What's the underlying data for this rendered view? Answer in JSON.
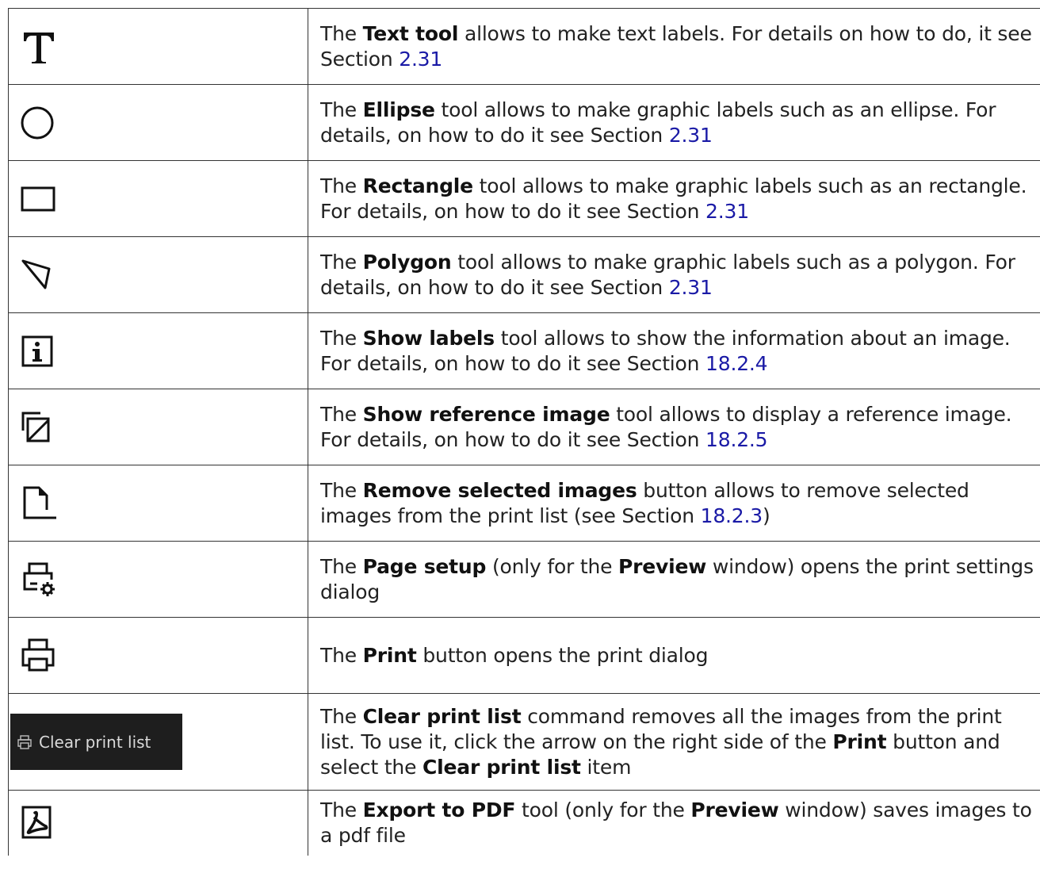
{
  "rows": [
    {
      "icon": "text-tool-icon",
      "parts": [
        {
          "t": "The "
        },
        {
          "t": "Text tool",
          "b": true
        },
        {
          "t": " allows to make text labels. For details on how to do, it see Section "
        },
        {
          "t": "2.31",
          "ref": true
        }
      ]
    },
    {
      "icon": "ellipse-icon",
      "parts": [
        {
          "t": "The "
        },
        {
          "t": "Ellipse",
          "b": true
        },
        {
          "t": " tool allows to make graphic labels such as an ellipse. For details, on how to do it see Section "
        },
        {
          "t": "2.31",
          "ref": true
        }
      ]
    },
    {
      "icon": "rectangle-icon",
      "parts": [
        {
          "t": "The "
        },
        {
          "t": "Rectangle",
          "b": true
        },
        {
          "t": " tool allows to make graphic labels such as an rectangle. For details, on how to do it see Section "
        },
        {
          "t": "2.31",
          "ref": true
        }
      ]
    },
    {
      "icon": "polygon-icon",
      "parts": [
        {
          "t": "The "
        },
        {
          "t": "Polygon",
          "b": true
        },
        {
          "t": " tool allows to make graphic labels such as a polygon. For details, on how to do it see Section "
        },
        {
          "t": "2.31",
          "ref": true
        }
      ]
    },
    {
      "icon": "info-icon",
      "parts": [
        {
          "t": "The "
        },
        {
          "t": "Show labels",
          "b": true
        },
        {
          "t": " tool allows to show the information about an image. For details, on how to do it see Section "
        },
        {
          "t": "18.2.4",
          "ref": true
        }
      ]
    },
    {
      "icon": "reference-image-icon",
      "parts": [
        {
          "t": "The "
        },
        {
          "t": "Show reference image",
          "b": true
        },
        {
          "t": " tool allows to display a reference image. For details, on how to do it see Section "
        },
        {
          "t": "18.2.5",
          "ref": true
        }
      ]
    },
    {
      "icon": "remove-document-icon",
      "parts": [
        {
          "t": "The "
        },
        {
          "t": "Remove selected images",
          "b": true
        },
        {
          "t": " button allows to remove selected images from the print list (see Section "
        },
        {
          "t": "18.2.3",
          "ref": true
        },
        {
          "t": ")"
        }
      ]
    },
    {
      "icon": "page-setup-icon",
      "parts": [
        {
          "t": "The "
        },
        {
          "t": "Page setup",
          "b": true
        },
        {
          "t": " (only for the "
        },
        {
          "t": "Preview",
          "b": true
        },
        {
          "t": " window) opens the print settings dialog"
        }
      ]
    },
    {
      "icon": "printer-icon",
      "parts": [
        {
          "t": "The "
        },
        {
          "t": "Print",
          "b": true
        },
        {
          "t": " button opens the print dialog"
        }
      ]
    },
    {
      "icon": "clear-print-list-button",
      "button_label": "Clear print list",
      "parts": [
        {
          "t": "The "
        },
        {
          "t": "Clear print list",
          "b": true
        },
        {
          "t": " command removes all the images from the print list. To use it, click the arrow on the right side of the "
        },
        {
          "t": "Print",
          "b": true
        },
        {
          "t": " button and select the "
        },
        {
          "t": "Clear print list",
          "b": true
        },
        {
          "t": " item"
        }
      ]
    },
    {
      "icon": "pdf-export-icon",
      "parts": [
        {
          "t": "The "
        },
        {
          "t": "Export to PDF",
          "b": true
        },
        {
          "t": " tool (only for the "
        },
        {
          "t": "Preview",
          "b": true
        },
        {
          "t": " window) saves images to a pdf file"
        }
      ]
    }
  ],
  "colors": {
    "text": "#222222",
    "link": "#1a1aa6",
    "border": "#333333",
    "button_bg": "#1e1e1e",
    "button_text": "#d9d9d9"
  }
}
